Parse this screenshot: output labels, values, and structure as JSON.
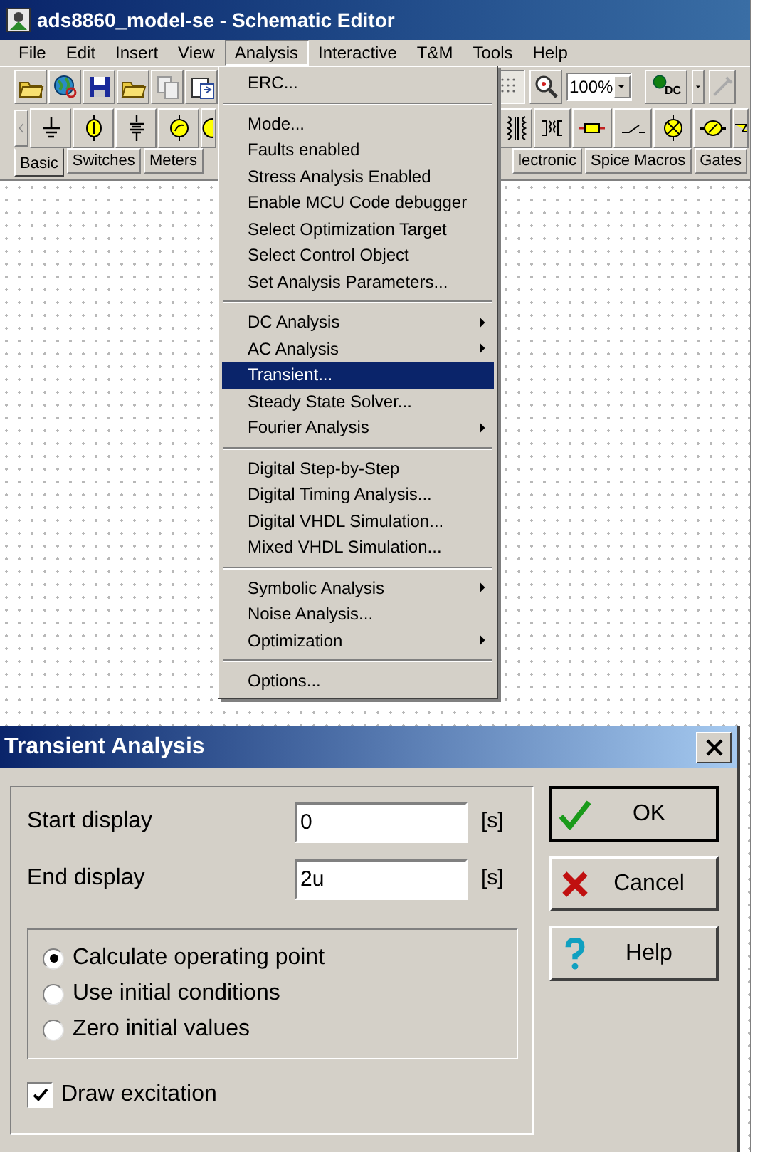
{
  "window": {
    "title": "ads8860_model-se - Schematic Editor"
  },
  "menu_bar": [
    {
      "label": "File",
      "selected": false
    },
    {
      "label": "Edit",
      "selected": false
    },
    {
      "label": "Insert",
      "selected": false
    },
    {
      "label": "View",
      "selected": false
    },
    {
      "label": "Analysis",
      "selected": true
    },
    {
      "label": "Interactive",
      "selected": false
    },
    {
      "label": "T&M",
      "selected": false
    },
    {
      "label": "Tools",
      "selected": false
    },
    {
      "label": "Help",
      "selected": false
    }
  ],
  "toolbar": {
    "zoom": "100%",
    "dc_label": "DC"
  },
  "component_tabs": [
    {
      "label": "Basic",
      "selected": true
    },
    {
      "label": "Switches",
      "selected": false
    },
    {
      "label": "Meters",
      "selected": false
    },
    {
      "label": "lectronic",
      "selected": false
    },
    {
      "label": "Spice Macros",
      "selected": false
    },
    {
      "label": "Gates",
      "selected": false
    }
  ],
  "analysis_menu": [
    {
      "kind": "item",
      "label": "ERC...",
      "submenu": false,
      "selected": false
    },
    {
      "kind": "separator"
    },
    {
      "kind": "item",
      "label": "Mode...",
      "submenu": false,
      "selected": false
    },
    {
      "kind": "item",
      "label": "Faults enabled",
      "submenu": false,
      "selected": false
    },
    {
      "kind": "item",
      "label": "Stress Analysis Enabled",
      "submenu": false,
      "selected": false
    },
    {
      "kind": "item",
      "label": "Enable MCU Code debugger",
      "submenu": false,
      "selected": false
    },
    {
      "kind": "item",
      "label": "Select Optimization Target",
      "submenu": false,
      "selected": false
    },
    {
      "kind": "item",
      "label": "Select Control Object",
      "submenu": false,
      "selected": false
    },
    {
      "kind": "item",
      "label": "Set Analysis Parameters...",
      "submenu": false,
      "selected": false
    },
    {
      "kind": "separator"
    },
    {
      "kind": "item",
      "label": "DC Analysis",
      "submenu": true,
      "selected": false
    },
    {
      "kind": "item",
      "label": "AC Analysis",
      "submenu": true,
      "selected": false
    },
    {
      "kind": "item",
      "label": "Transient...",
      "submenu": false,
      "selected": true
    },
    {
      "kind": "item",
      "label": "Steady State Solver...",
      "submenu": false,
      "selected": false
    },
    {
      "kind": "item",
      "label": "Fourier Analysis",
      "submenu": true,
      "selected": false
    },
    {
      "kind": "separator"
    },
    {
      "kind": "item",
      "label": "Digital Step-by-Step",
      "submenu": false,
      "selected": false
    },
    {
      "kind": "item",
      "label": "Digital Timing Analysis...",
      "submenu": false,
      "selected": false
    },
    {
      "kind": "item",
      "label": "Digital VHDL Simulation...",
      "submenu": false,
      "selected": false
    },
    {
      "kind": "item",
      "label": "Mixed VHDL Simulation...",
      "submenu": false,
      "selected": false
    },
    {
      "kind": "separator"
    },
    {
      "kind": "item",
      "label": "Symbolic Analysis",
      "submenu": true,
      "selected": false
    },
    {
      "kind": "item",
      "label": "Noise Analysis...",
      "submenu": false,
      "selected": false
    },
    {
      "kind": "item",
      "label": "Optimization",
      "submenu": true,
      "selected": false
    },
    {
      "kind": "separator"
    },
    {
      "kind": "item",
      "label": "Options...",
      "submenu": false,
      "selected": false
    }
  ],
  "dialog": {
    "title": "Transient Analysis",
    "fields": [
      {
        "label": "Start display",
        "value": "0",
        "unit": "[s]"
      },
      {
        "label": "End display",
        "value": "2u",
        "unit": "[s]"
      }
    ],
    "options": [
      {
        "label": "Calculate operating point",
        "selected": true
      },
      {
        "label": "Use initial conditions",
        "selected": false
      },
      {
        "label": "Zero initial values",
        "selected": false
      }
    ],
    "draw_excitation": {
      "label": "Draw excitation",
      "checked": true
    },
    "buttons": [
      {
        "kind": "ok",
        "label": "OK"
      },
      {
        "kind": "cancel",
        "label": "Cancel"
      },
      {
        "kind": "help",
        "label": "Help"
      }
    ]
  }
}
